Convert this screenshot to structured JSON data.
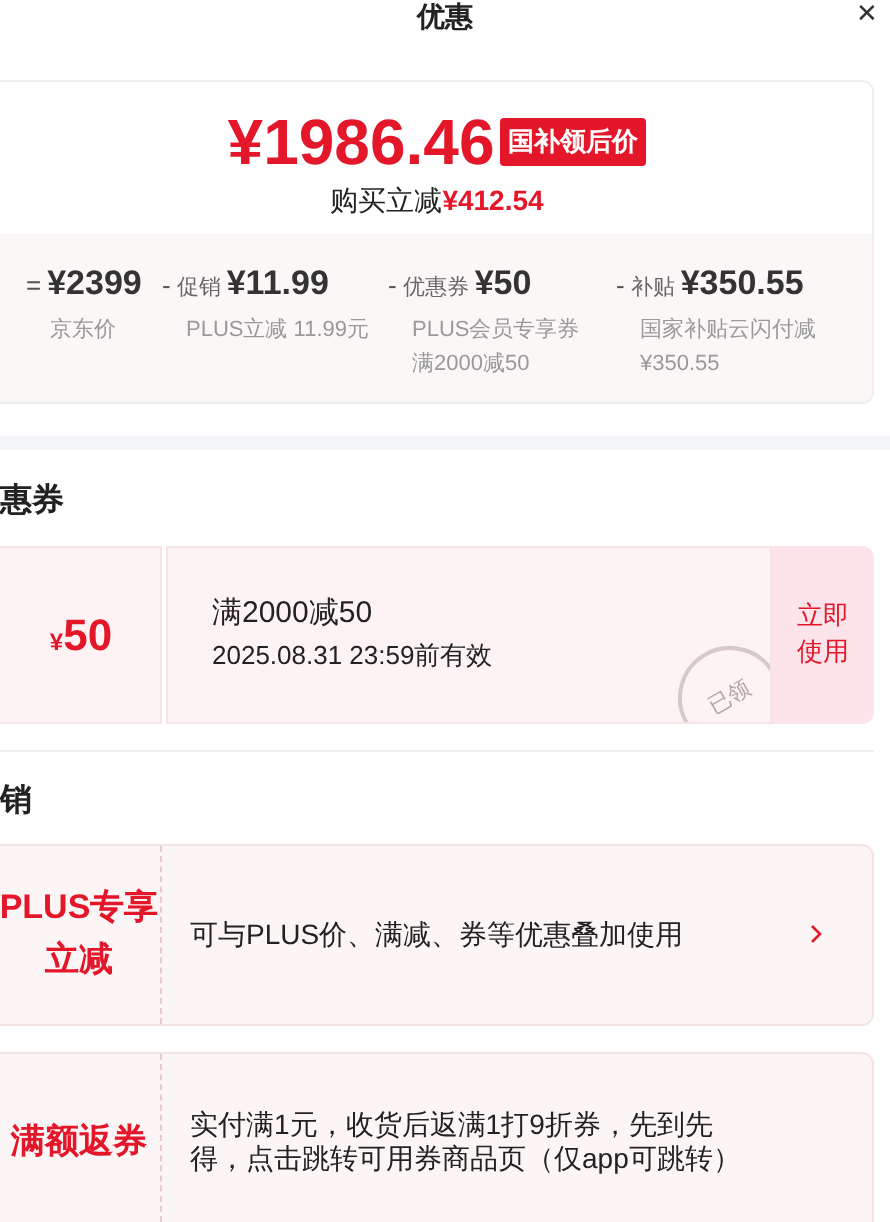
{
  "header": {
    "title": "优惠",
    "close": "✕"
  },
  "summary": {
    "price": "¥1986.46",
    "badge": "国补领后价",
    "savings_label": "购买立减",
    "savings_amount": "¥412.54"
  },
  "breakdown": [
    {
      "op": "=",
      "amount": "¥2399",
      "notes": [
        "京东价"
      ]
    },
    {
      "op": "-",
      "label": "促销",
      "amount": "¥11.99",
      "notes": [
        "PLUS立减 11.99元"
      ]
    },
    {
      "op": "-",
      "label": "优惠券",
      "amount": "¥50",
      "notes": [
        "PLUS会员专享券",
        "满2000减50"
      ]
    },
    {
      "op": "-",
      "label": "补贴",
      "amount": "¥350.55",
      "notes": [
        "国家补贴云闪付减",
        "¥350.55"
      ]
    }
  ],
  "coupon_section": {
    "heading": "惠券",
    "coupon": {
      "currency": "¥",
      "value": "50",
      "condition": "满2000减50",
      "validity": "2025.08.31 23:59前有效",
      "stamp": "已领",
      "button": "立即使用"
    }
  },
  "promo_section": {
    "heading": "销",
    "promotions": [
      {
        "label": "PLUS专享立减",
        "description": "可与PLUS价、满减、券等优惠叠加使用",
        "has_arrow": true
      },
      {
        "label": "满额返券",
        "description": "实付满1元，收货后返满1打9折券，先到先得，点击跳转可用券商品页（仅app可跳转）",
        "has_arrow": false
      }
    ]
  }
}
